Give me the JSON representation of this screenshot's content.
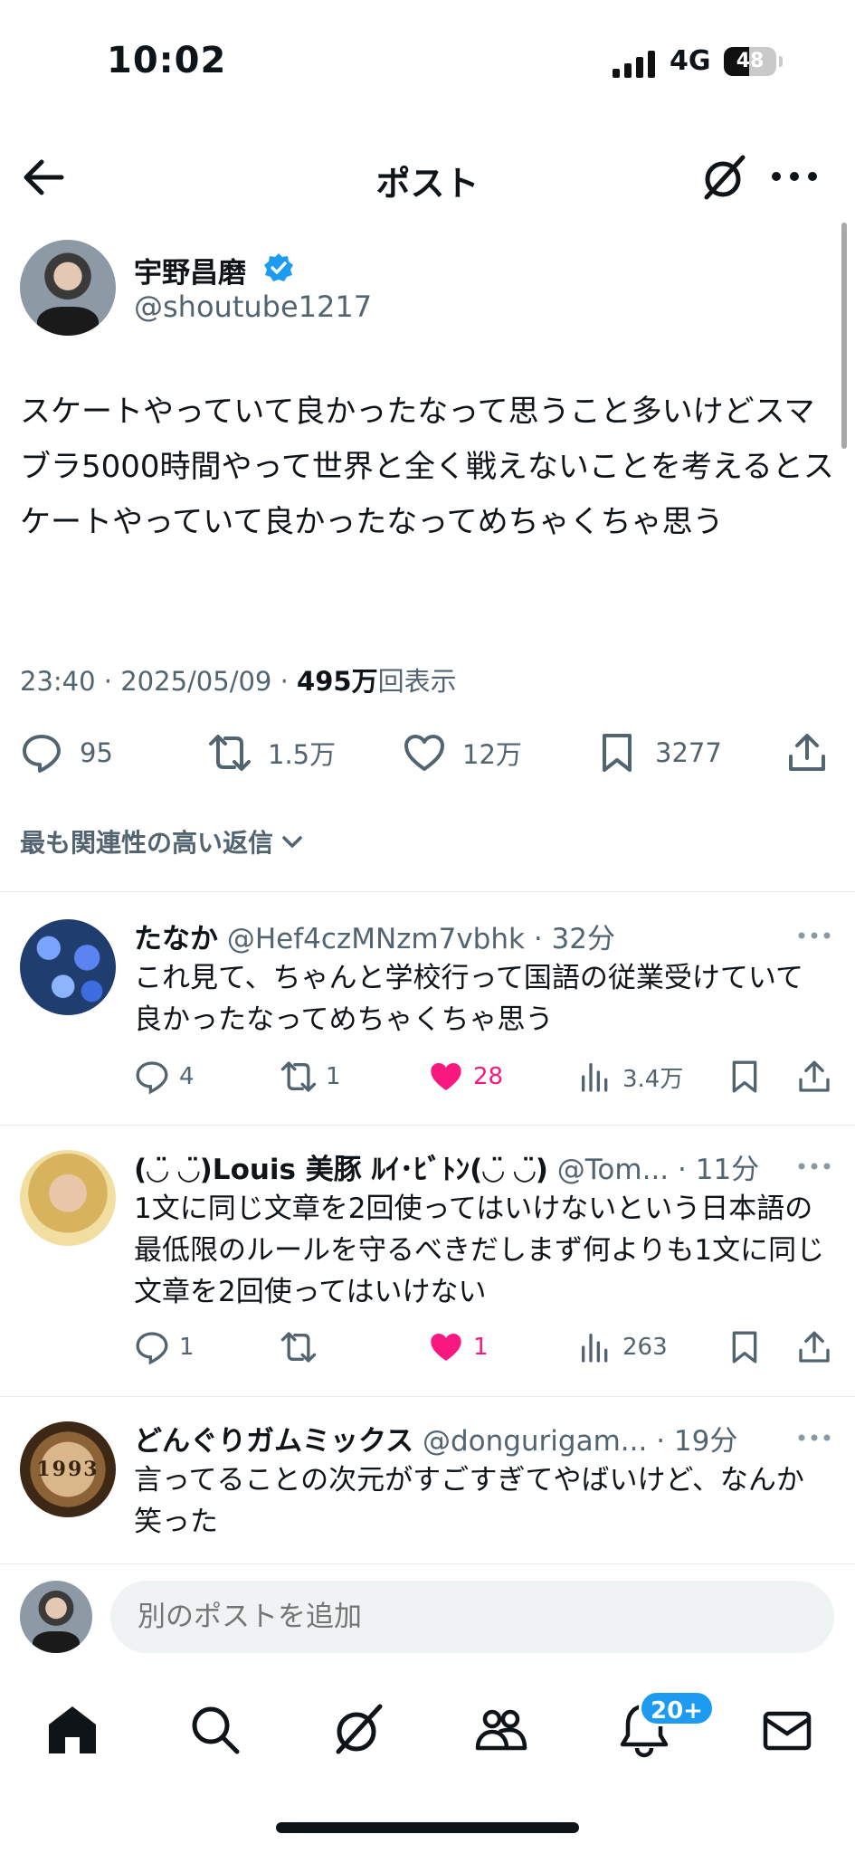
{
  "status_bar": {
    "time": "10:02",
    "network": "4G",
    "battery": "48",
    "battery_level": 0.48
  },
  "header": {
    "title": "ポスト",
    "back_icon": "arrow-left-icon",
    "grok_icon": "grok-icon",
    "more_icon": "more-icon"
  },
  "post": {
    "author": {
      "name": "宇野昌磨",
      "handle": "@shoutube1217",
      "verified": true
    },
    "text": "スケートやっていて良かったなって思うこと多いけどスマブラ5000時間やって世界と全く戦えないことを考えるとスケートやっていて良かったなってめちゃくちゃ思う",
    "time": "23:40",
    "date": "2025/05/09",
    "meta_sep": "·",
    "views": "495万",
    "views_label": "回表示",
    "stats": {
      "replies": "95",
      "reposts": "1.5万",
      "likes": "12万",
      "bookmarks": "3277"
    }
  },
  "sort": {
    "label": "最も関連性の高い返信"
  },
  "replies": [
    {
      "name": "たなか",
      "handle": "@Hef4czMNzm7vbhk",
      "time": "· 32分",
      "text": "これ見て、ちゃんと学校行って国語の従業受けていて良かったなってめちゃくちゃ思う",
      "replies": "4",
      "reposts": "1",
      "likes": "28",
      "views": "3.4万",
      "liked": true
    },
    {
      "name": "(◡̈ ◡̈)Louis 美豚 ﾙｲ･ﾋﾞﾄﾝ(◡̈ ◡̈)",
      "handle": "@Tom...",
      "time": "· 11分",
      "text": "1文に同じ文章を2回使ってはいけないという日本語の最低限のルールを守るべきだしまず何よりも1文に同じ文章を2回使ってはいけない",
      "replies": "1",
      "reposts": "",
      "likes": "1",
      "views": "263",
      "liked": true
    },
    {
      "name": "どんぐりガムミックス",
      "handle": "@dongurigam...",
      "time": "· 19分",
      "text": "言ってることの次元がすごすぎてやばいけど、なんか笑った",
      "avatar_text": "1993"
    }
  ],
  "composer": {
    "placeholder": "別のポストを追加"
  },
  "nav": {
    "notifications_badge": "20+"
  },
  "colors": {
    "accent": "#1d9bf0",
    "like": "#f91880",
    "secondary_text": "#536471"
  }
}
